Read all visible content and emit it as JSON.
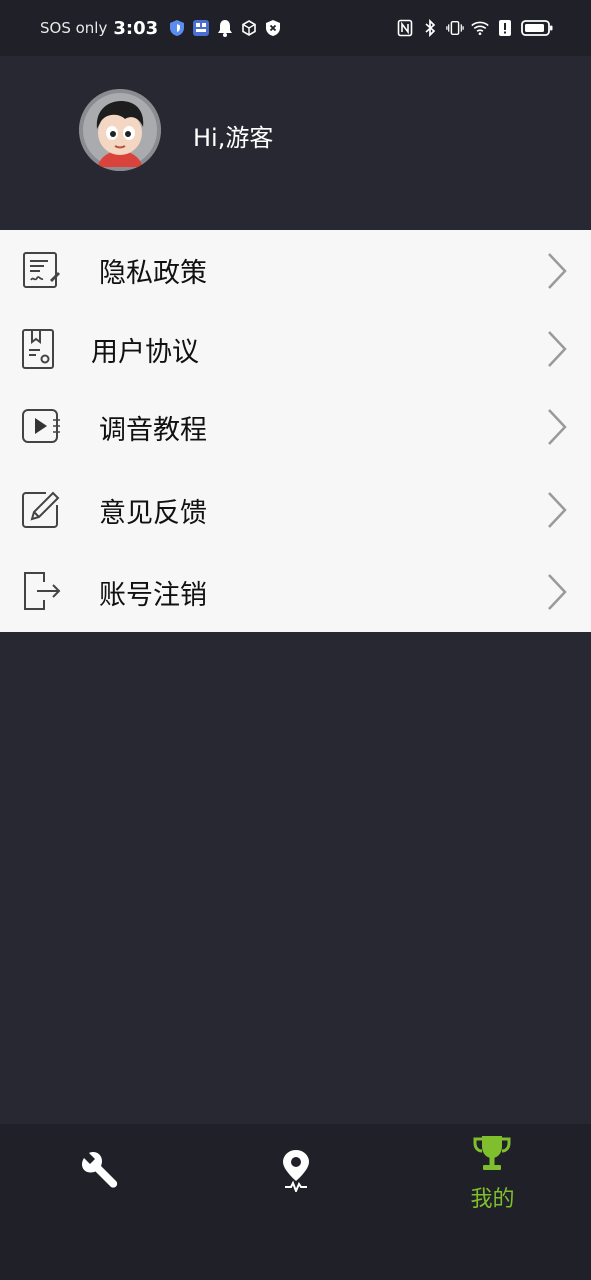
{
  "status_bar": {
    "sos": "SOS only",
    "time": "3:03"
  },
  "profile": {
    "greeting": "Hi,游客"
  },
  "menu": {
    "items": [
      {
        "label": "隐私政策",
        "icon": "privacy-document-icon"
      },
      {
        "label": "用户协议",
        "icon": "user-agreement-icon"
      },
      {
        "label": "调音教程",
        "icon": "video-tutorial-icon"
      },
      {
        "label": "意见反馈",
        "icon": "feedback-edit-icon"
      },
      {
        "label": "账号注销",
        "icon": "logout-icon"
      }
    ]
  },
  "bottom_nav": {
    "tabs": [
      {
        "icon": "wrench-icon",
        "label": ""
      },
      {
        "icon": "location-pin-icon",
        "label": ""
      },
      {
        "icon": "trophy-icon",
        "label": "我的",
        "active": true
      }
    ],
    "active_color": "#7fbf2e"
  }
}
